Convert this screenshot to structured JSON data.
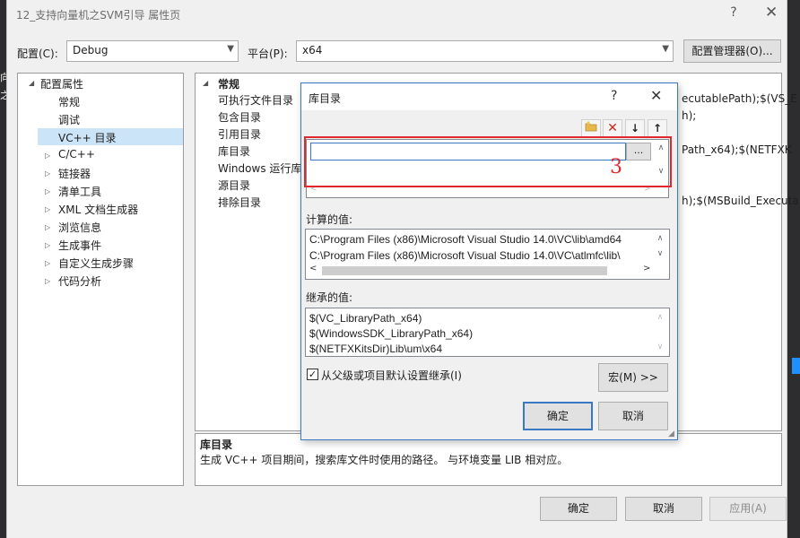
{
  "background": {
    "left_glyphs": [
      "向",
      "之"
    ]
  },
  "window": {
    "title": "12_支持向量机之SVM引导 属性页",
    "help_label": "?",
    "close_label": "✕"
  },
  "config_bar": {
    "config_label": "配置(C):",
    "config_value": "Debug",
    "platform_label": "平台(P):",
    "platform_value": "x64",
    "manager_button": "配置管理器(O)..."
  },
  "tree": {
    "root": "配置属性",
    "items": [
      "常规",
      "调试",
      "VC++ 目录",
      "C/C++",
      "链接器",
      "清单工具",
      "XML 文档生成器",
      "浏览信息",
      "生成事件",
      "自定义生成步骤",
      "代码分析"
    ],
    "selected": "VC++ 目录"
  },
  "grid": {
    "section": "常规",
    "rows": [
      {
        "name": "可执行文件目录",
        "value": "ecutablePath);$(VS_E"
      },
      {
        "name": "包含目录",
        "value": "h);"
      },
      {
        "name": "引用目录",
        "value": ""
      },
      {
        "name": "库目录",
        "value": "Path_x64);$(NETFXK"
      },
      {
        "name": "Windows 运行库",
        "value": ""
      },
      {
        "name": "源目录",
        "value": ""
      },
      {
        "name": "排除目录",
        "value": "h);$(MSBuild_Executa"
      }
    ]
  },
  "description": {
    "title": "库目录",
    "text": "生成 VC++ 项目期间，搜索库文件时使用的路径。 与环境变量 LIB 相对应。"
  },
  "dialog": {
    "title": "库目录",
    "help_label": "?",
    "close_label": "✕",
    "toolbar_icons": [
      "new-folder-icon",
      "delete-icon",
      "move-down-icon",
      "move-up-icon"
    ],
    "edit_value": "",
    "browse_label": "...",
    "annotation": "3",
    "computed_label": "计算的值:",
    "computed_values": [
      "C:\\Program Files (x86)\\Microsoft Visual Studio 14.0\\VC\\lib\\amd64",
      "C:\\Program Files (x86)\\Microsoft Visual Studio 14.0\\VC\\atlmfc\\lib\\"
    ],
    "inherited_label": "继承的值:",
    "inherited_values": [
      "$(VC_LibraryPath_x64)",
      "$(WindowsSDK_LibraryPath_x64)",
      "$(NETFXKitsDir)Lib\\um\\x64"
    ],
    "inherit_checkbox": "从父级或项目默认设置继承(I)",
    "inherit_checked": true,
    "macro_button": "宏(M) >>",
    "ok_button": "确定",
    "cancel_button": "取消"
  },
  "footer": {
    "ok_button": "确定",
    "cancel_button": "取消",
    "apply_button": "应用(A)"
  },
  "colors": {
    "selection": "#cce4f7",
    "dialog_border": "#3a78c4",
    "annotation_red": "#e0282e",
    "ide_dark": "#2d2d30"
  }
}
